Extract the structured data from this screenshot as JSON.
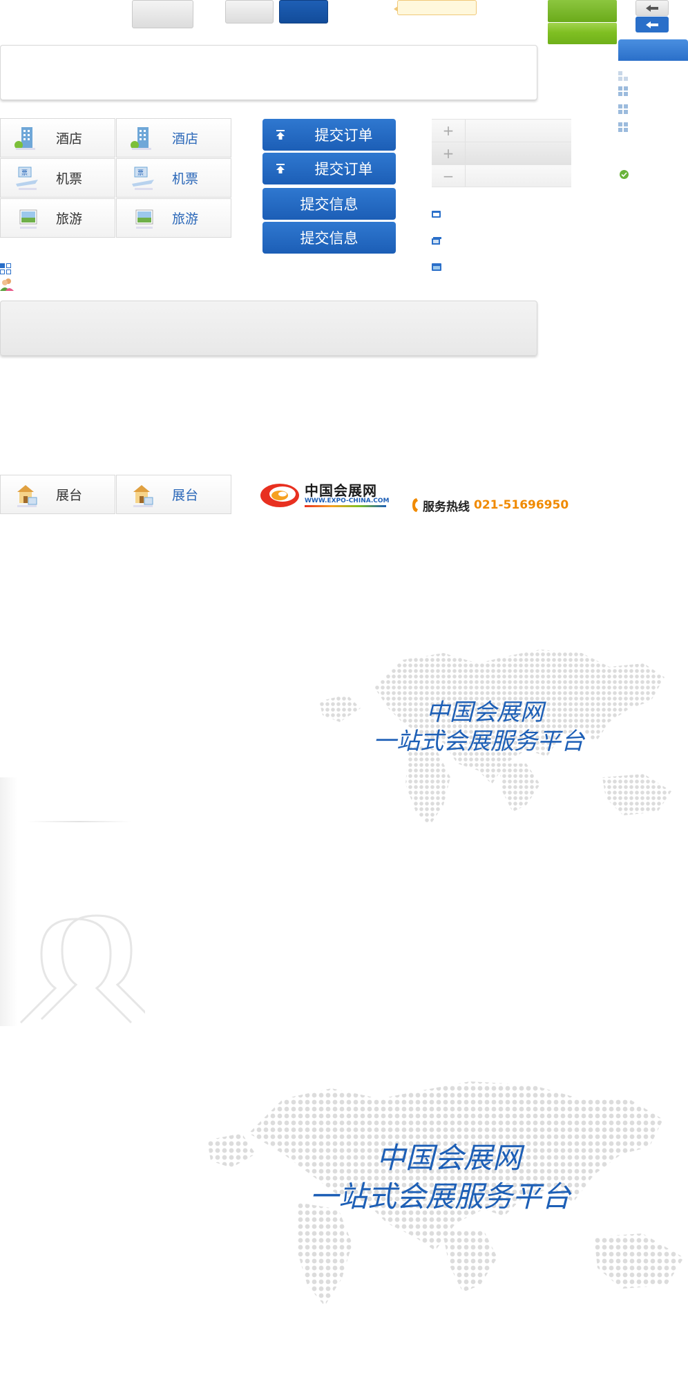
{
  "tiles": {
    "hotel": "酒店",
    "ticket": "机票",
    "travel": "旅游",
    "booth": "展台"
  },
  "buttons": {
    "submit_order": "提交订单",
    "submit_info": "提交信息"
  },
  "stepper": {
    "plus": "+",
    "minus": "−"
  },
  "header": {
    "logo_cn": "中国会展网",
    "logo_en": "WWW.EXPO-CHINA.COM",
    "hotline_label": "服务热线",
    "hotline_number": "021-51696950"
  },
  "banner": {
    "line1": "中国会展网",
    "line2": "一站式会展服务平台"
  },
  "colors": {
    "accent_blue": "#1c5eb6",
    "brand_orange": "#f08a00",
    "green": "#7fbf22"
  }
}
